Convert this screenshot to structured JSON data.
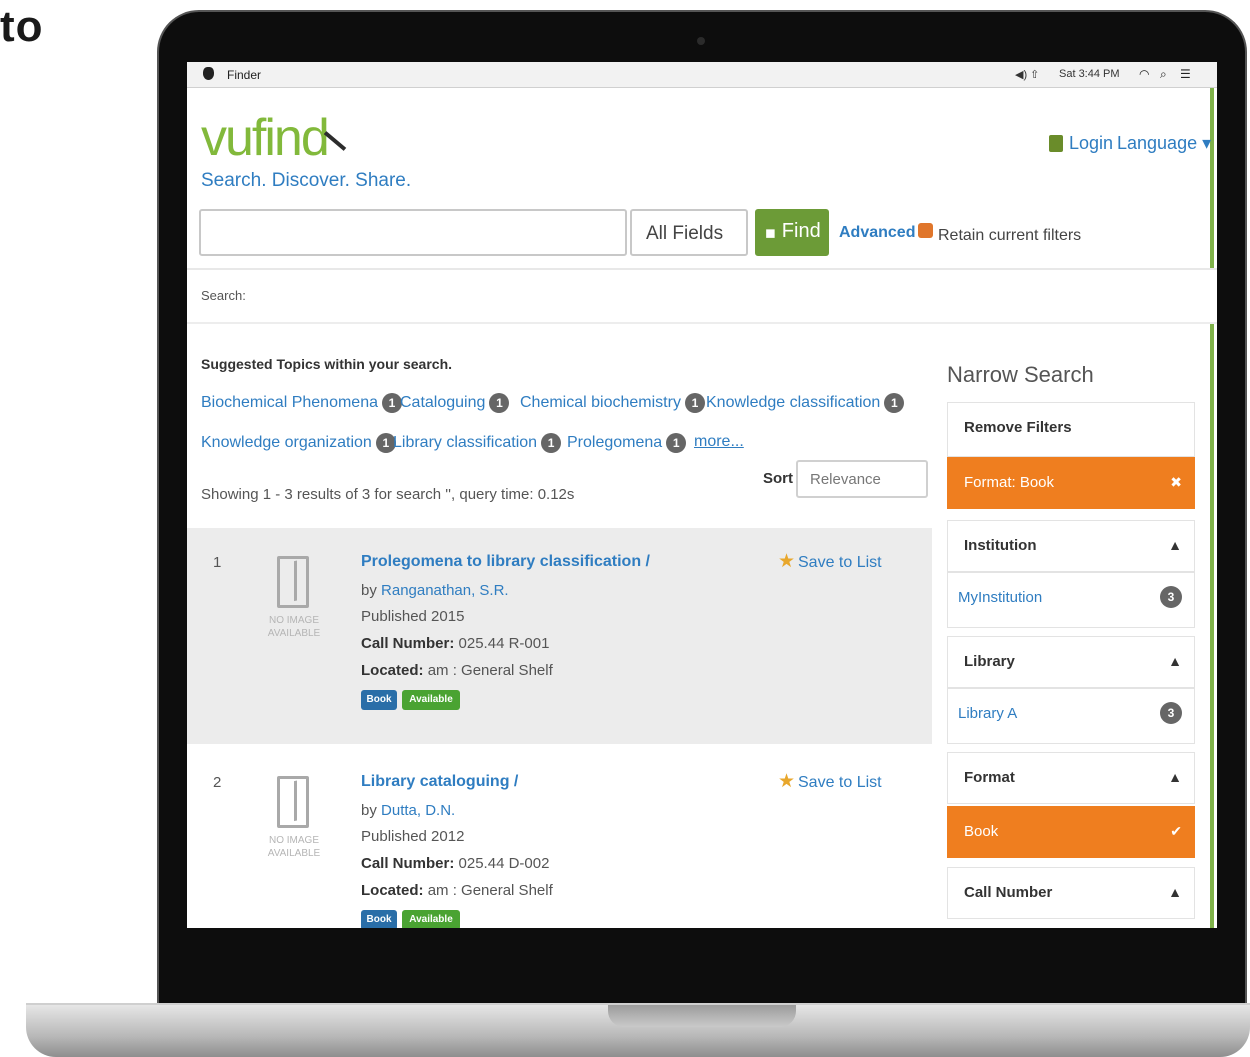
{
  "side_text": "to",
  "menubar": {
    "app": "Finder",
    "status": "◀) ⇧",
    "clock": "Sat 3:44 PM"
  },
  "header": {
    "logo": "vufind",
    "tagline": "Search. Discover. Share.",
    "login": "Login",
    "language": "Language ▾"
  },
  "search": {
    "query": "",
    "field": "All Fields",
    "find_label": "Find",
    "advanced": "Advanced",
    "retain": "Retain current filters"
  },
  "breadcrumb": "Search:",
  "suggested": {
    "heading": "Suggested Topics within your search.",
    "topics": [
      {
        "label": "Biochemical Phenomena",
        "count": "1"
      },
      {
        "label": "Cataloguing",
        "count": "1"
      },
      {
        "label": "Chemical biochemistry",
        "count": "1"
      },
      {
        "label": "Knowledge classification",
        "count": "1"
      },
      {
        "label": "Knowledge organization",
        "count": "1"
      },
      {
        "label": "Library classification",
        "count": "1"
      },
      {
        "label": "Prolegomena",
        "count": "1"
      }
    ],
    "more": "more..."
  },
  "results_meta": {
    "showing": "Showing 1 - 3 results of 3 for search '', query time: 0.12s",
    "sort_label": "Sort",
    "sort_value": "Relevance"
  },
  "results": [
    {
      "num": "1",
      "thumb_caption": "NO IMAGE AVAILABLE",
      "title": "Prolegomena to library classification /",
      "by": "by",
      "author": "Ranganathan, S.R.",
      "published": "Published 2015",
      "call_label": "Call Number:",
      "call_value": "025.44 R-001",
      "located_label": "Located:",
      "located_value": "am : General Shelf",
      "format": "Book",
      "availability": "Available",
      "save": "Save to List"
    },
    {
      "num": "2",
      "thumb_caption": "NO IMAGE AVAILABLE",
      "title": "Library cataloguing /",
      "by": "by",
      "author": "Dutta, D.N.",
      "published": "Published 2012",
      "call_label": "Call Number:",
      "call_value": "025.44 D-002",
      "located_label": "Located:",
      "located_value": "am : General Shelf",
      "format": "Book",
      "availability": "Available",
      "save": "Save to List"
    }
  ],
  "sidebar": {
    "title": "Narrow Search",
    "remove_filters": "Remove Filters",
    "active_filter": "Format: Book",
    "active_filter_icon": "✖",
    "institution": "Institution",
    "institution_value": "MyInstitution",
    "institution_count": "3",
    "library": "Library",
    "library_value": "Library A",
    "library_count": "3",
    "format": "Format",
    "format_value": "Book",
    "format_check": "✔",
    "call_number": "Call Number",
    "caret_up": "▲"
  },
  "colors": {
    "brand_green": "#82b93b",
    "link_blue": "#2f7dc1",
    "facet_orange": "#ef7e1f",
    "find_green": "#6c9b37"
  }
}
